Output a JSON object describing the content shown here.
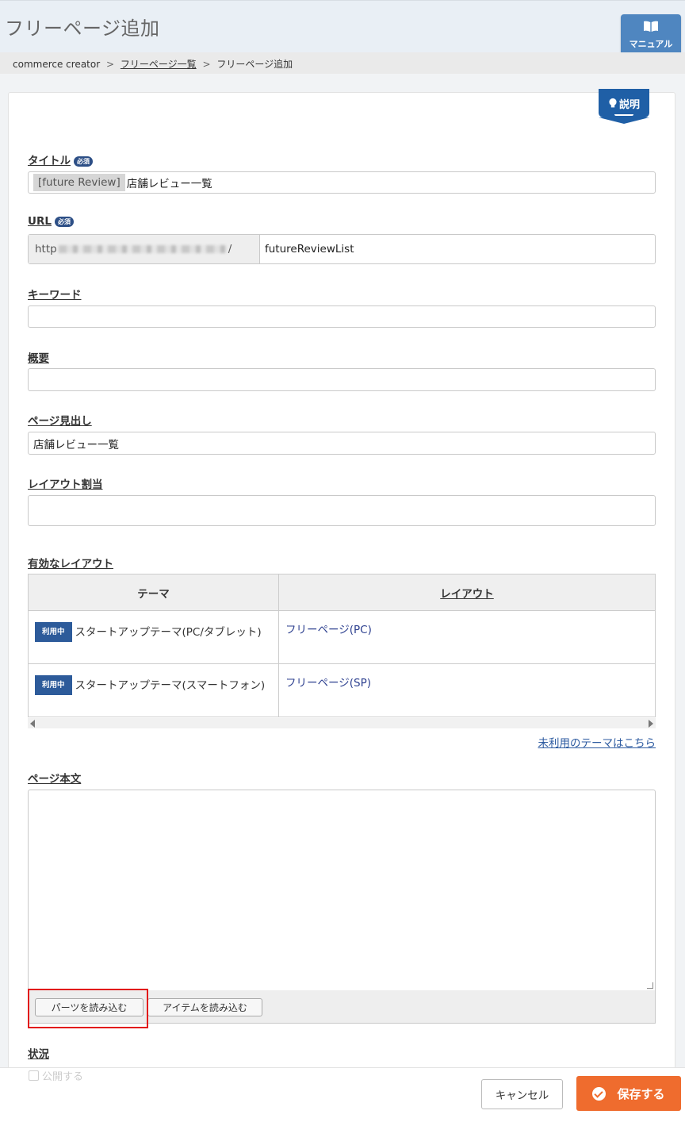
{
  "header": {
    "title": "フリーページ追加",
    "manual_label": "マニュアル"
  },
  "breadcrumb": {
    "root": "commerce creator",
    "sep1": ">",
    "parent": "フリーページ一覧",
    "sep2": ">",
    "current": "フリーページ追加"
  },
  "help_badge": "説明",
  "required_badge": "必須",
  "form": {
    "title": {
      "label": "タイトル",
      "prefix": "[future Review]",
      "value": "店舗レビュー一覧"
    },
    "url": {
      "label": "URL",
      "base_start": "http",
      "base_end": "/",
      "value": "futureReviewList"
    },
    "keyword": {
      "label": "キーワード",
      "value": ""
    },
    "summary": {
      "label": "概要",
      "value": ""
    },
    "heading": {
      "label": "ページ見出し",
      "value": "店舗レビュー一覧"
    },
    "layout_assign": {
      "label": "レイアウト割当",
      "value": ""
    },
    "valid_layouts": {
      "label": "有効なレイアウト",
      "columns": [
        "テーマ",
        "レイアウト"
      ],
      "rows": [
        {
          "badge": "利用中",
          "theme": "スタートアップテーマ(PC/タブレット)",
          "layout": "フリーページ(PC)"
        },
        {
          "badge": "利用中",
          "theme": "スタートアップテーマ(スマートフォン)",
          "layout": "フリーページ(SP)"
        }
      ],
      "unused_link": "未利用のテーマはこちら"
    },
    "body": {
      "label": "ページ本文",
      "value": "",
      "load_parts": "パーツを読み込む",
      "load_items": "アイテムを読み込む"
    },
    "status": {
      "label": "状況",
      "checkbox_label": "公開する"
    }
  },
  "footer": {
    "cancel": "キャンセル",
    "save": "保存する"
  },
  "colors": {
    "accent": "#ef6c2e",
    "primary": "#1f5fa6",
    "highlight": "#e21b1b"
  }
}
